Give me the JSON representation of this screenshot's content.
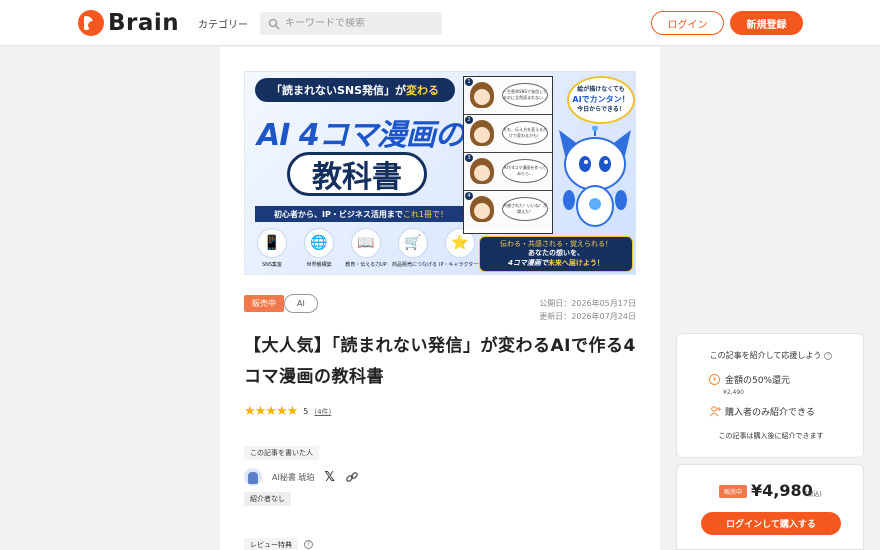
{
  "header": {
    "logo_text": "Brain",
    "category_label": "カテゴリー",
    "search_placeholder": "キーワードで検索",
    "login_label": "ログイン",
    "register_label": "新規登録"
  },
  "banner": {
    "pill_text_a": "「読まれないSNS発信」が",
    "pill_text_b": "変わる",
    "title_line1": "AI 4コマ漫画の",
    "title_line2": "教科書",
    "subtitle_a": "初心者から、IP・ビジネス活用まで",
    "subtitle_b": "これ1冊で！",
    "icons": [
      {
        "label": "SNS集客",
        "icon": "phone-heart-icon",
        "glyph": "📱"
      },
      {
        "label": "世界観構築",
        "icon": "globe-icon",
        "glyph": "🌐"
      },
      {
        "label": "教育・伝える力UP",
        "icon": "book-icon",
        "glyph": "📖"
      },
      {
        "label": "商品販売につなげる",
        "icon": "cart-icon",
        "glyph": "🛒"
      },
      {
        "label": "IP・キャラクター化",
        "icon": "star-icon",
        "glyph": "⭐"
      }
    ],
    "comic_panels": [
      {
        "num": "1",
        "text": "一生懸命SNSで発信してるのに全然読まれない…"
      },
      {
        "num": "2",
        "text": "それ、伝え方を変えるだけで変わるかも！"
      },
      {
        "num": "3",
        "text": "AIで4コマ漫画を作ってみたら…"
      },
      {
        "num": "4",
        "text": "共感された！いいね！が増えた！"
      }
    ],
    "note_line1": "絵が描けなくても",
    "note_line2": "AIでカンタン！",
    "note_line3": "今日からできる！",
    "cta_line1": "伝わる・共感される・覚えられる！",
    "cta_line2": "あなたの想いを、",
    "cta_line3a": "4コマ漫画で",
    "cta_line3b": "未来へ届けよう！"
  },
  "article": {
    "status_tag": "販売中",
    "category_tag": "AI",
    "published": "公開日：2026年05月17日",
    "updated": "更新日：2026年07月24日",
    "title": "【大人気】「読まれない発信」が変わるAIで作る4コマ漫画の教科書",
    "stars": "★★★★★",
    "rating_value": "5",
    "rating_count": "(4件)",
    "author_section_label": "この記事を書いた人",
    "author_name": "AI秘書 琥珀",
    "referrer_tag": "紹介者なし",
    "review_label": "レビュー特典",
    "review_help": "?"
  },
  "affiliate": {
    "title": "この記事を紹介して応援しよう",
    "help": "?",
    "coin_glyph": "¥",
    "reward_text": "金額の50%還元",
    "reward_amount": "¥2,490",
    "condition_text": "購入者のみ紹介できる",
    "note": "この記事は購入後に紹介できます"
  },
  "purchase": {
    "status_tag": "販売中",
    "price": "¥4,980",
    "tax_note": "(税込)",
    "button_label": "ログインして購入する"
  },
  "colors": {
    "accent": "#f4581f",
    "star": "#f6b400"
  }
}
